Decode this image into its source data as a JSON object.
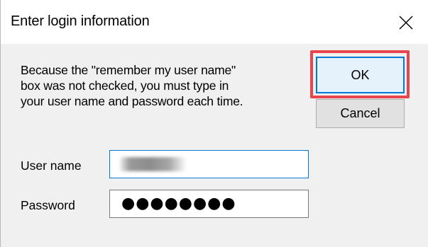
{
  "window": {
    "title": "Enter login information",
    "close_icon": "close-icon"
  },
  "message": {
    "text": "Because the \"remember my user name\"\nbox was not checked, you must type in\nyour user name and password each time."
  },
  "buttons": {
    "ok_label": "OK",
    "cancel_label": "Cancel",
    "highlight_color": "#e8454f"
  },
  "form": {
    "username_label": "User name",
    "username_value_note": "redacted",
    "password_label": "Password",
    "password_mask": "●●●●●●●●"
  },
  "colors": {
    "accent": "#0078d7",
    "dialog_bg": "#f0f0f0"
  }
}
